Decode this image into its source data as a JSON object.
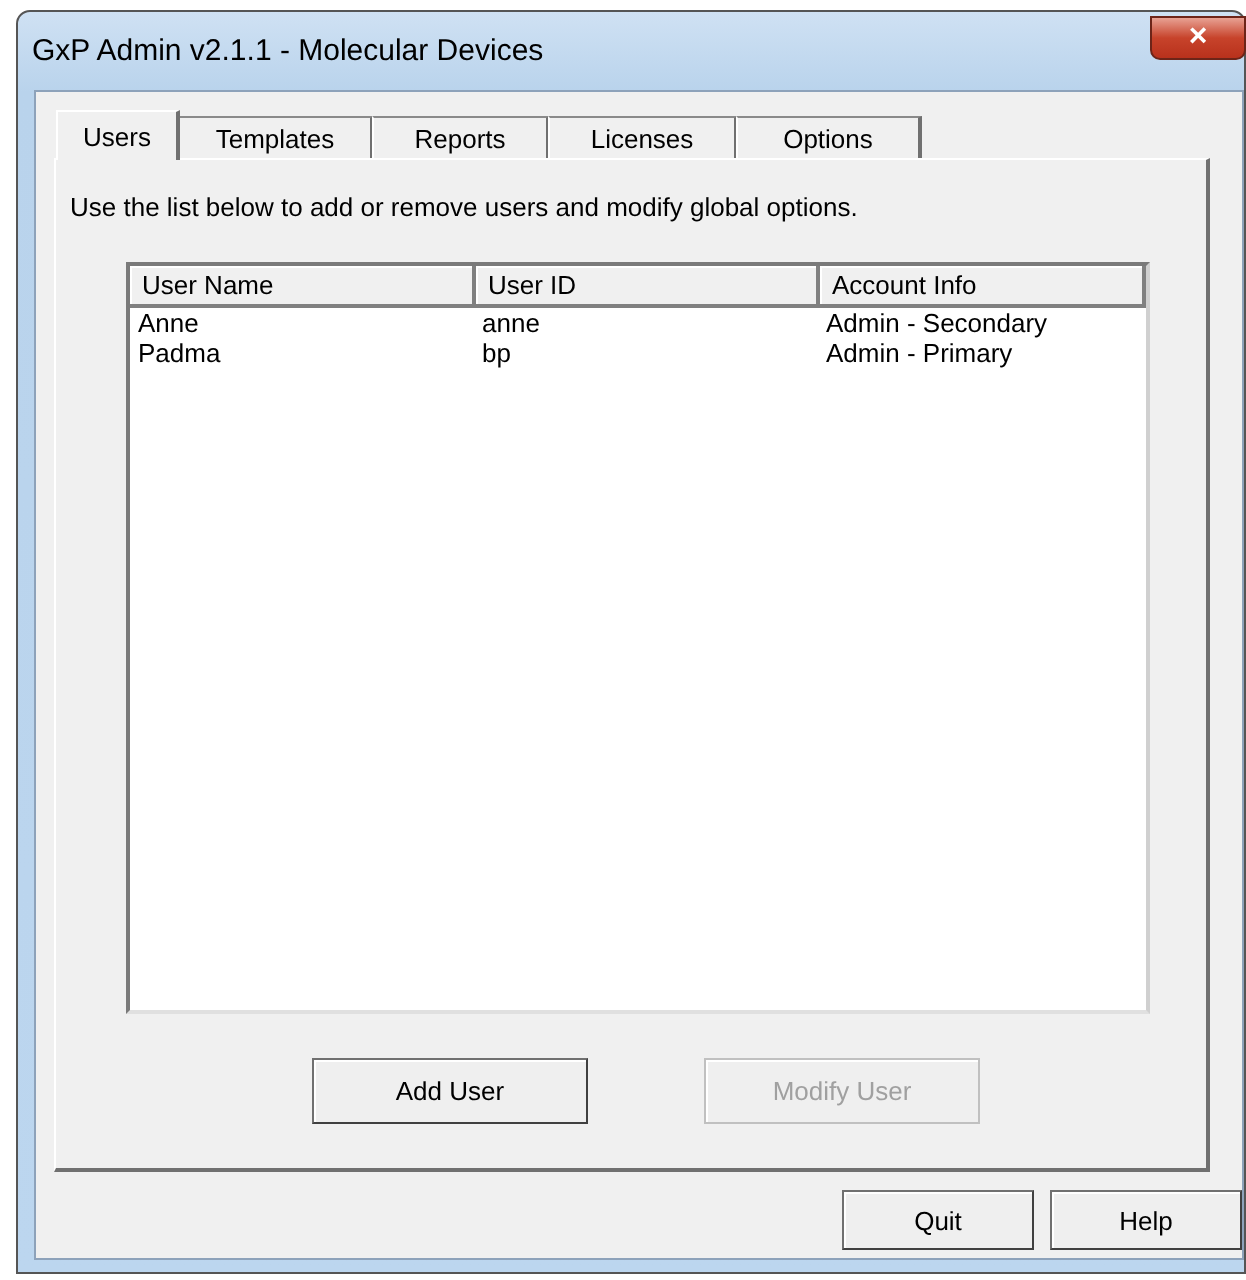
{
  "window": {
    "title": "GxP Admin v2.1.1 - Molecular Devices",
    "close": "×"
  },
  "tabs": [
    {
      "label": "Users",
      "selected": true
    },
    {
      "label": "Templates",
      "selected": false
    },
    {
      "label": "Reports",
      "selected": false
    },
    {
      "label": "Licenses",
      "selected": false
    },
    {
      "label": "Options",
      "selected": false
    }
  ],
  "instructions": "Use the list below to add or remove users and modify global options.",
  "table": {
    "columns": [
      "User Name",
      "User ID",
      "Account Info"
    ],
    "rows": [
      [
        "Anne",
        "anne",
        "Admin - Secondary"
      ],
      [
        "Padma",
        "bp",
        "Admin - Primary"
      ]
    ]
  },
  "panel_buttons": [
    {
      "label": "Add User",
      "disabled": false
    },
    {
      "label": "Modify User",
      "disabled": true
    }
  ],
  "dialog_buttons": [
    {
      "label": "Quit",
      "disabled": false
    },
    {
      "label": "Help",
      "disabled": false
    }
  ]
}
